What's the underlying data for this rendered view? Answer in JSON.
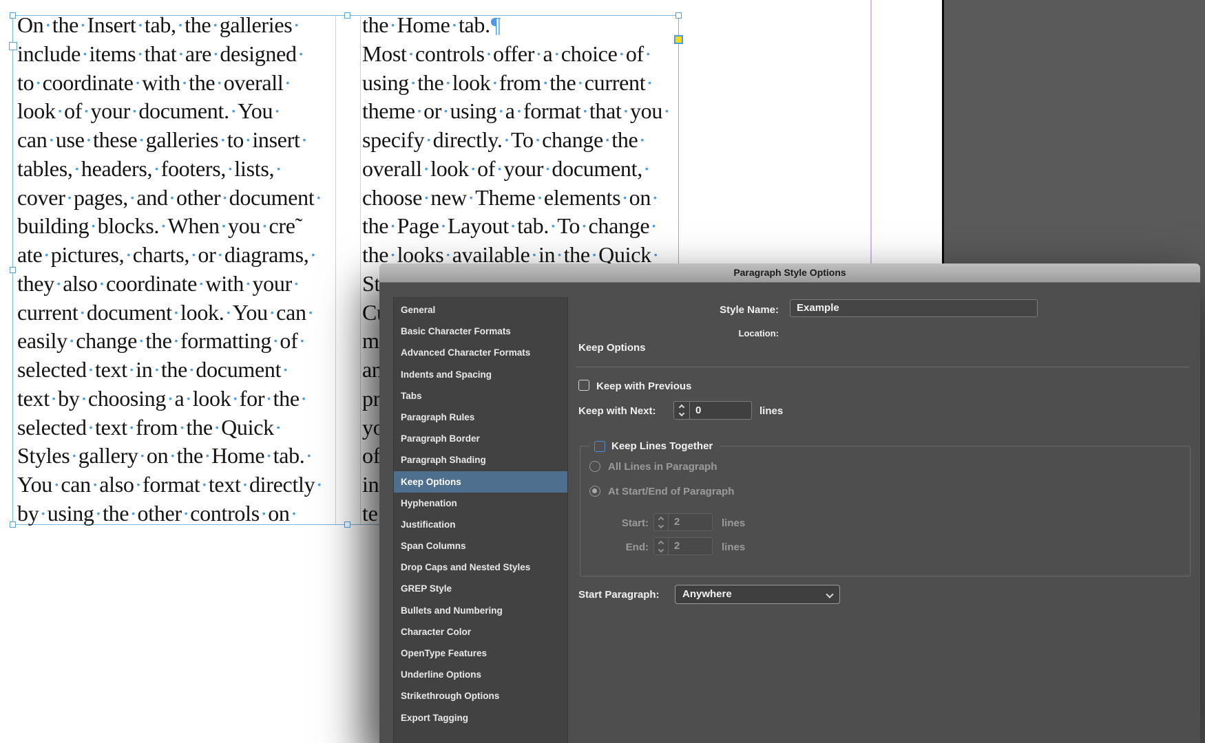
{
  "document": {
    "column1_lines": [
      "On·the·Insert·tab,·the·galleries·",
      "include·items·that·are·designed·",
      "to·coordinate·with·the·overall·",
      "look·of·your·document.·You·",
      "can·use·these·galleries·to·insert·",
      "tables,·headers,·footers,·lists,·",
      "cover·pages,·and·other·document·",
      "building·blocks.·When·you·cre˜",
      "ate·pictures,·charts,·or·diagrams,·",
      "they·also·coordinate·with·your·",
      "current·document·look.·You·can·",
      "easily·change·the·formatting·of·",
      "selected·text·in·the·document·",
      "text·by·choosing·a·look·for·the·",
      "selected·text·from·the·Quick·",
      "Styles·gallery·on·the·Home·tab.·",
      "You·can·also·format·text·directly·",
      "by·using·the·other·controls·on·"
    ],
    "column2_lines": [
      "the·Home·tab.¶",
      "Most·controls·offer·a·choice·of·",
      "using·the·look·from·the·current·",
      "theme·or·using·a·format·that·you·",
      "specify·directly.·To·change·the·",
      "overall·look·of·your·document,·",
      "choose·new·Theme·elements·on·",
      "the·Page·Layout·tab.·To·change·",
      "the·looks·available·in·the·Quick·",
      "St",
      "Cu",
      "m",
      "an",
      "pr",
      "yo",
      "of",
      "in",
      "te"
    ]
  },
  "dialog": {
    "title": "Paragraph Style Options",
    "sidebar": {
      "selected": "Keep Options",
      "items": [
        "General",
        "Basic Character Formats",
        "Advanced Character Formats",
        "Indents and Spacing",
        "Tabs",
        "Paragraph Rules",
        "Paragraph Border",
        "Paragraph Shading",
        "Keep Options",
        "Hyphenation",
        "Justification",
        "Span Columns",
        "Drop Caps and Nested Styles",
        "GREP Style",
        "Bullets and Numbering",
        "Character Color",
        "OpenType Features",
        "Underline Options",
        "Strikethrough Options",
        "Export Tagging"
      ]
    },
    "style_name_label": "Style Name:",
    "style_name_value": "Example",
    "location_label": "Location:",
    "section_heading": "Keep Options",
    "keep_with_previous_label": "Keep with Previous",
    "keep_with_next_label": "Keep with Next:",
    "keep_with_next_value": "0",
    "keep_with_next_unit": "lines",
    "keep_lines_together_label": "Keep Lines Together",
    "all_lines_label": "All Lines in Paragraph",
    "start_end_label": "At Start/End of Paragraph",
    "start_label": "Start:",
    "start_value": "2",
    "start_unit": "lines",
    "end_label": "End:",
    "end_value": "2",
    "end_unit": "lines",
    "start_paragraph_label": "Start Paragraph:",
    "start_paragraph_value": "Anywhere",
    "colors": {
      "sidebar_selection": "#4e6f8e",
      "accent_checkbox_blue": "#4a90d9",
      "frame_blue": "#7db4de",
      "guide_purple": "#dcb5f2",
      "corner_widget_yellow": "#ffd900",
      "hidden_character_blue": "#4d9be0",
      "pasteboard_grey": "#5a5a5a",
      "dialog_grey": "#4e4e4e"
    }
  }
}
